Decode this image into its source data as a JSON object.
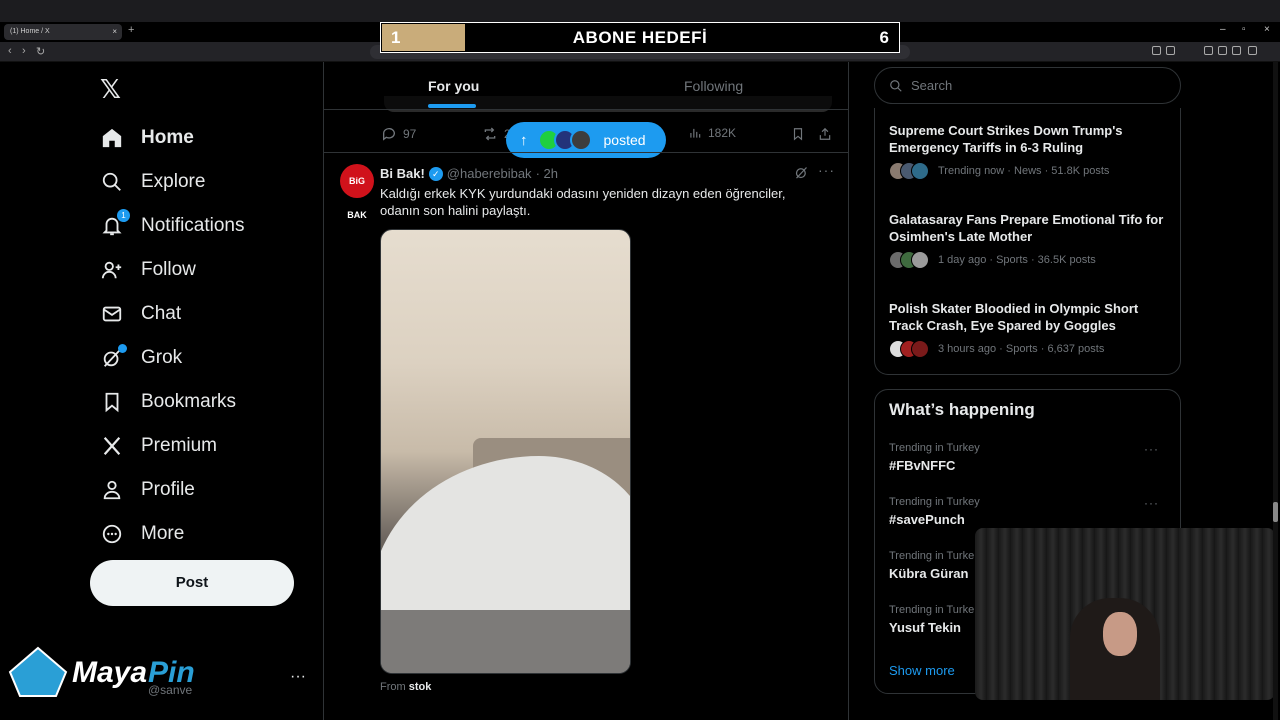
{
  "browser": {
    "tab_title": "(1) Home / X",
    "tab_close": "×",
    "new_tab": "+",
    "back": "‹",
    "forward": "›",
    "reload": "↻",
    "win_min": "–",
    "win_max": "▫",
    "win_close": "×"
  },
  "banner": {
    "current": "1",
    "title": "ABONE HEDEFİ",
    "target": "6",
    "progress_fraction": 0.16
  },
  "nav": {
    "logo": "𝕏",
    "items": [
      {
        "label": "Home",
        "icon": "home-icon"
      },
      {
        "label": "Explore",
        "icon": "search-icon"
      },
      {
        "label": "Notifications",
        "icon": "bell-icon",
        "badge": "1"
      },
      {
        "label": "Follow",
        "icon": "follow-icon"
      },
      {
        "label": "Chat",
        "icon": "mail-icon"
      },
      {
        "label": "Grok",
        "icon": "grok-icon"
      },
      {
        "label": "Bookmarks",
        "icon": "bookmark-icon"
      },
      {
        "label": "Premium",
        "icon": "x-icon"
      },
      {
        "label": "Profile",
        "icon": "person-icon"
      },
      {
        "label": "More",
        "icon": "more-circle-icon"
      }
    ],
    "post_label": "Post",
    "account_handle": "@sanve",
    "account_more": "···"
  },
  "timeline": {
    "tabs": [
      {
        "label": "For you",
        "active": true
      },
      {
        "label": "Following",
        "active": false
      }
    ],
    "prev_actions": {
      "replies": "97",
      "reposts": "2",
      "views": "182K"
    },
    "posted_pill": {
      "label": "posted",
      "arrow": "↑"
    },
    "tweet": {
      "avatar_text": "BiG BAK",
      "name": "Bi Bak!",
      "verified": "✓",
      "handle": "@haberebibak",
      "time": "· 2h",
      "text": "Kaldığı erkek KYK yurdundaki odasını yeniden dizayn eden öğrenciler, odanın son halini paylaştı.",
      "from_prefix": "From",
      "from_source": "stok",
      "more": "···"
    }
  },
  "sidebar": {
    "search_placeholder": "Search",
    "news": [
      {
        "title": "Supreme Court Strikes Down Trump's Emergency Tariffs in 6-3 Ruling",
        "meta": "Trending now · News · 51.8K posts"
      },
      {
        "title": "Galatasaray Fans Prepare Emotional Tifo for Osimhen's Late Mother",
        "meta": "1 day ago · Sports · 36.5K posts"
      },
      {
        "title": "Polish Skater Bloodied in Olympic Short Track Crash, Eye Spared by Goggles",
        "meta": "3 hours ago · Sports · 6,637 posts"
      }
    ],
    "whats_happening": "What’s happening",
    "trends": [
      {
        "context": "Trending in Turkey",
        "name": "#FBvNFFC"
      },
      {
        "context": "Trending in Turkey",
        "name": "#savePunch"
      },
      {
        "context": "Trending in Turke",
        "name": "Kübra Güran"
      },
      {
        "context": "Trending in Turke",
        "name": "Yusuf Tekin"
      }
    ],
    "trend_more": "···",
    "show_more": "Show more"
  },
  "colors": {
    "accent": "#1d9bf0",
    "background": "#000000",
    "banner_progress": "#c9ac7a"
  }
}
